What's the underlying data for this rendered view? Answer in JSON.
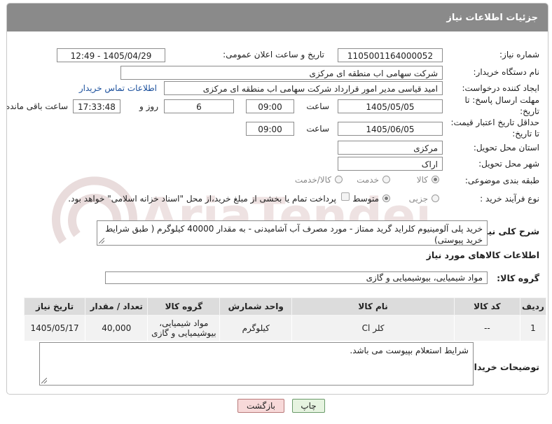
{
  "header": {
    "title": "جزئیات اطلاعات نیاز"
  },
  "form": {
    "need_number": {
      "label": "شماره نیاز:",
      "value": "1105001164000052"
    },
    "announce_datetime": {
      "label": "تاریخ و ساعت اعلان عمومی:",
      "value": "1405/04/29 - 12:49"
    },
    "buyer_org": {
      "label": "نام دستگاه خریدار:",
      "value": "شرکت سهامی اب منطقه ای مرکزی"
    },
    "requester": {
      "label": "ایجاد کننده درخواست:",
      "value": "امید قیاسی مدیر امور قرارداد شرکت سهامی اب منطقه ای مرکزی",
      "contact_link": "اطلاعات تماس خریدار"
    },
    "reply_deadline": {
      "label_line1": "مهلت ارسال پاسخ: تا",
      "label_line2": "تاریخ:",
      "date": "1405/05/05",
      "time_label": "ساعت",
      "time": "09:00",
      "days": "6",
      "days_label": "روز و",
      "remaining": "17:33:48",
      "remaining_label": "ساعت باقی مانده"
    },
    "price_validity": {
      "label_line1": "حداقل تاریخ اعتبار قیمت:",
      "label_line2": "تا تاریخ:",
      "date": "1405/06/05",
      "time_label": "ساعت",
      "time": "09:00"
    },
    "province": {
      "label": "استان محل تحویل:",
      "value": "مرکزی"
    },
    "city": {
      "label": "شهر محل تحویل:",
      "value": "اراک"
    },
    "category": {
      "label": "طبقه بندی موضوعی:",
      "options": [
        "کالا",
        "خدمت",
        "کالا/خدمت"
      ],
      "selected": "کالا"
    },
    "purchase_type": {
      "label": "نوع فرآیند خرید :",
      "options": [
        "جزیی",
        "متوسط"
      ],
      "selected": "متوسط",
      "payment_note": "پرداخت تمام یا بخشی از مبلغ خرید،از محل \"اسناد خزانه اسلامی\" خواهد بود."
    }
  },
  "description": {
    "label": "شرح کلی نیاز:",
    "value": "خرید پلی آلومینیوم کلراید گرید ممتاز - مورد مصرف آب آشامیدنی - به مقدار 40000 کیلوگرم ( طبق شرایط خرید پیوستی)"
  },
  "goods_info": {
    "title": "اطلاعات کالاهای مورد نیاز",
    "group_label": "گروه کالا:",
    "group_value": "مواد شیمیایی، بیوشیمیایی و گازی"
  },
  "table": {
    "headers": [
      "ردیف",
      "کد کالا",
      "نام کالا",
      "واحد شمارش",
      "گروه کالا",
      "تعداد / مقدار",
      "تاریخ نیاز"
    ],
    "rows": [
      [
        "1",
        "--",
        "کلر Cl",
        "کیلوگرم",
        "مواد شیمیایی، بیوشیمیایی و گازی",
        "40,000",
        "1405/05/17"
      ]
    ]
  },
  "buyer_notes": {
    "label": "توضیحات خریدار:",
    "value": "شرایط استعلام بپیوست می باشد."
  },
  "buttons": {
    "print": "چاپ",
    "back": "بازگشت"
  },
  "watermark": {
    "text": "AriaTender.net"
  },
  "colors": {
    "header_bg": "#8a8a8a",
    "link": "#1a4f9c",
    "back_button_bg": "#f7d9d9",
    "print_button_bg": "#e6f3e0"
  }
}
